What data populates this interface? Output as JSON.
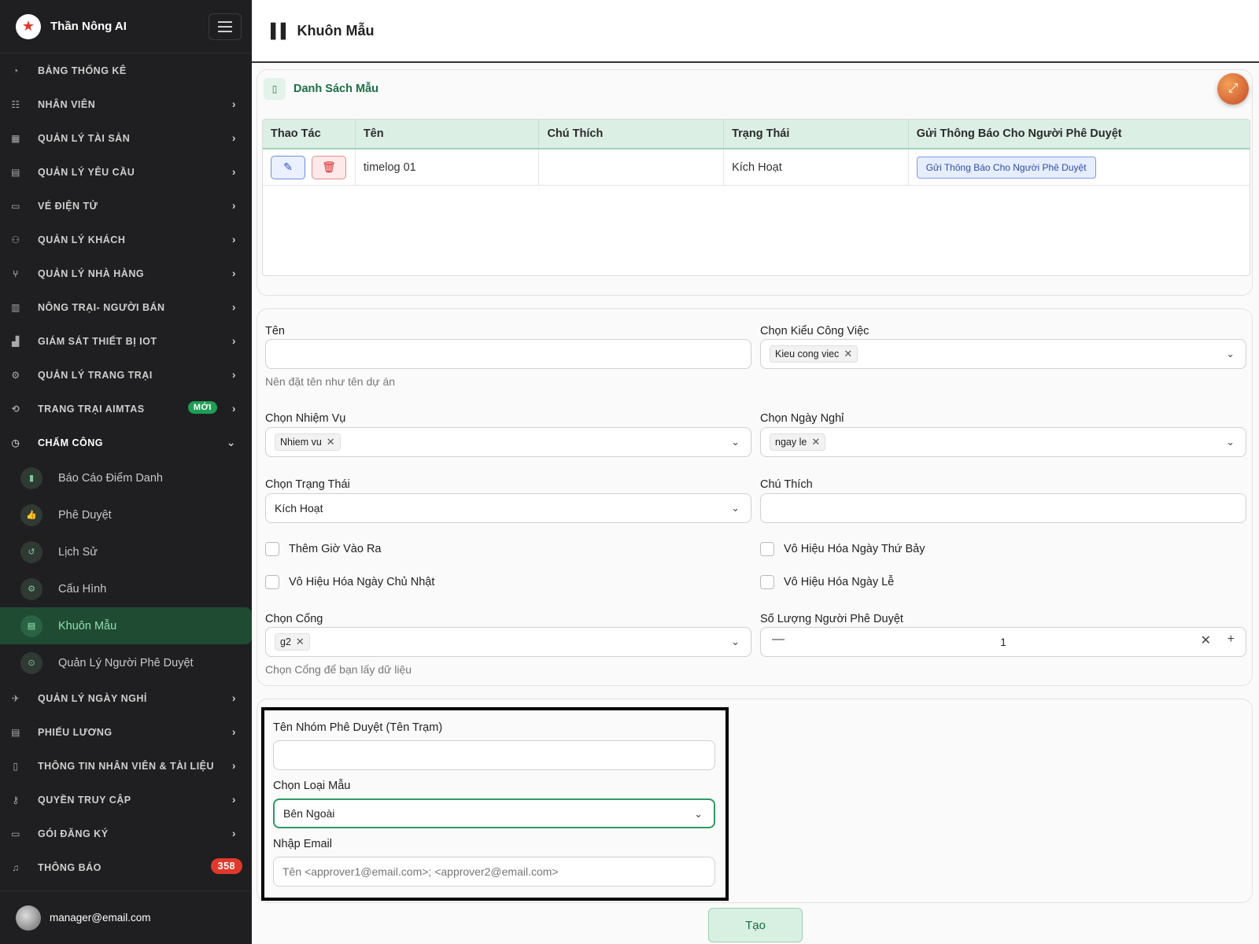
{
  "app": {
    "title": "Thần Nông AI",
    "page_title": "Khuôn Mẫu"
  },
  "sidebar": {
    "items": [
      {
        "label": "BẢNG THỐNG KÊ",
        "icon": "dashboard-icon"
      },
      {
        "label": "NHÂN VIÊN",
        "icon": "users-icon"
      },
      {
        "label": "QUẢN LÝ TÀI SẢN",
        "icon": "assets-icon"
      },
      {
        "label": "QUẢN LÝ YÊU CẦU",
        "icon": "clipboard-icon"
      },
      {
        "label": "VÉ ĐIỆN TỬ",
        "icon": "ticket-icon"
      },
      {
        "label": "QUẢN LÝ KHÁCH",
        "icon": "guests-icon"
      },
      {
        "label": "QUẢN LÝ NHÀ HÀNG",
        "icon": "restaurant-icon"
      },
      {
        "label": "NÔNG TRẠI- NGƯỜI BÁN",
        "icon": "store-icon"
      },
      {
        "label": "GIÁM SÁT THIẾT BỊ IOT",
        "icon": "iot-icon"
      },
      {
        "label": "QUẢN LÝ TRANG TRẠI",
        "icon": "tractor-icon"
      },
      {
        "label": "TRANG TRẠI AIMTAS",
        "icon": "handshake-icon",
        "badge": "MỚI"
      },
      {
        "label": "CHẤM CÔNG",
        "icon": "clock-icon"
      }
    ],
    "subitems": [
      {
        "label": "Báo Cáo Điểm Danh",
        "icon": "chart-icon"
      },
      {
        "label": "Phê Duyệt",
        "icon": "thumbs-up-icon"
      },
      {
        "label": "Lịch Sử",
        "icon": "history-icon"
      },
      {
        "label": "Cấu Hình",
        "icon": "gear-icon"
      },
      {
        "label": "Khuôn Mẫu",
        "icon": "template-icon"
      },
      {
        "label": "Quản Lý Người Phê Duyệt",
        "icon": "approver-icon"
      }
    ],
    "items_after": [
      {
        "label": "QUẢN LÝ NGÀY NGHỈ",
        "icon": "plane-icon"
      },
      {
        "label": "PHIẾU LƯƠNG",
        "icon": "payslip-icon"
      },
      {
        "label": "THÔNG TIN NHÂN VIÊN & TÀI LIỆU",
        "icon": "documents-icon"
      },
      {
        "label": "QUYỀN TRUY CẬP",
        "icon": "key-icon"
      },
      {
        "label": "GÓI ĐĂNG KÝ",
        "icon": "card-icon"
      },
      {
        "label": "THÔNG BÁO",
        "icon": "bell-icon",
        "count": "358"
      }
    ],
    "user_email": "manager@email.com"
  },
  "list": {
    "title": "Danh Sách Mẫu",
    "columns": [
      "Thao Tác",
      "Tên",
      "Chú Thích",
      "Trạng Thái",
      "Gửi Thông Báo Cho Người Phê Duyệt"
    ],
    "rows": [
      {
        "name": "timelog 01",
        "note": "",
        "status": "Kích Hoạt",
        "notify_label": "Gửi Thông Báo Cho Người Phê Duyệt"
      }
    ]
  },
  "form": {
    "name_label": "Tên",
    "name_value": "",
    "name_help": "Nên đặt tên như tên dự án",
    "work_type_label": "Chọn Kiểu Công Việc",
    "work_type_chip": "Kieu cong viec",
    "task_label": "Chọn Nhiệm Vụ",
    "task_chip": "Nhiem vu",
    "holiday_label": "Chọn Ngày Nghỉ",
    "holiday_chip": "ngay le",
    "status_label": "Chọn Trạng Thái",
    "status_value": "Kích Hoạt",
    "note_label": "Chú Thích",
    "note_value": "",
    "check_add_inout": "Thêm Giờ Vào Ra",
    "check_disable_saturday": "Vô Hiệu Hóa Ngày Thứ Bảy",
    "check_disable_sunday": "Vô Hiệu Hóa Ngày Chủ Nhật",
    "check_disable_holiday": "Vô Hiệu Hóa Ngày Lễ",
    "gate_label": "Chọn Cổng",
    "gate_chip": "g2",
    "gate_help": "Chọn Cổng để bạn lấy dữ liệu",
    "approver_count_label": "Số Lượng Người Phê Duyệt",
    "approver_count_value": "1"
  },
  "approver": {
    "group_label": "Tên Nhóm Phê Duyệt (Tên Trạm)",
    "group_value": "",
    "type_label": "Chọn Loại Mẫu",
    "type_value": "Bên Ngoài",
    "email_label": "Nhập Email",
    "email_placeholder": "Tên <approver1@email.com>; <approver2@email.com>"
  },
  "actions": {
    "create_label": "Tạo"
  }
}
